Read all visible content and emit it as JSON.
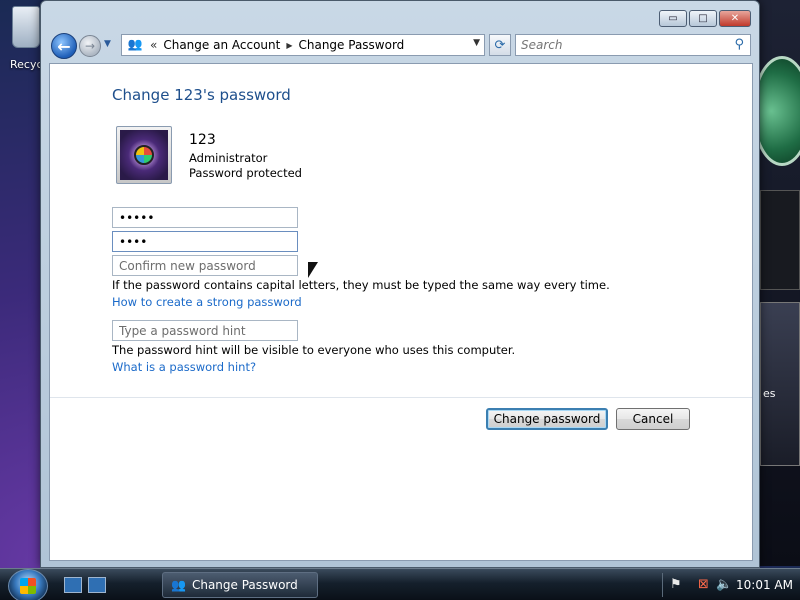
{
  "desktop": {
    "recycle_label": "Recyc",
    "gadget_feed_text": "es"
  },
  "window": {
    "caption": {
      "minimize": "▭",
      "maximize": "□",
      "close": "✕"
    },
    "nav": {
      "back_icon": "←",
      "forward_icon": "→",
      "dropdown_icon": "▼"
    },
    "address": {
      "separator": "«",
      "crumbs": [
        "Change an Account",
        "Change Password"
      ],
      "dropdown_icon": "▼"
    },
    "refresh_icon": "⟳",
    "search": {
      "placeholder": "Search",
      "icon": "⚲"
    }
  },
  "content": {
    "title": "Change 123's password",
    "user": {
      "name": "123",
      "role": "Administrator",
      "status": "Password protected"
    },
    "fields": {
      "current_password_value": "•••••",
      "new_password_value": "••••",
      "confirm_placeholder": "Confirm new password",
      "hint_placeholder": "Type a password hint"
    },
    "notes": {
      "capital_letters": "If the password contains capital letters, they must be typed the same way every time.",
      "hint_visibility": "The password hint will be visible to everyone who uses this computer."
    },
    "links": {
      "strong_password": "How to create a strong password",
      "password_hint": "What is a password hint?"
    },
    "buttons": {
      "change": "Change password",
      "cancel": "Cancel"
    }
  },
  "taskbar": {
    "task_label": "Change Password",
    "clock": "10:01 AM"
  }
}
